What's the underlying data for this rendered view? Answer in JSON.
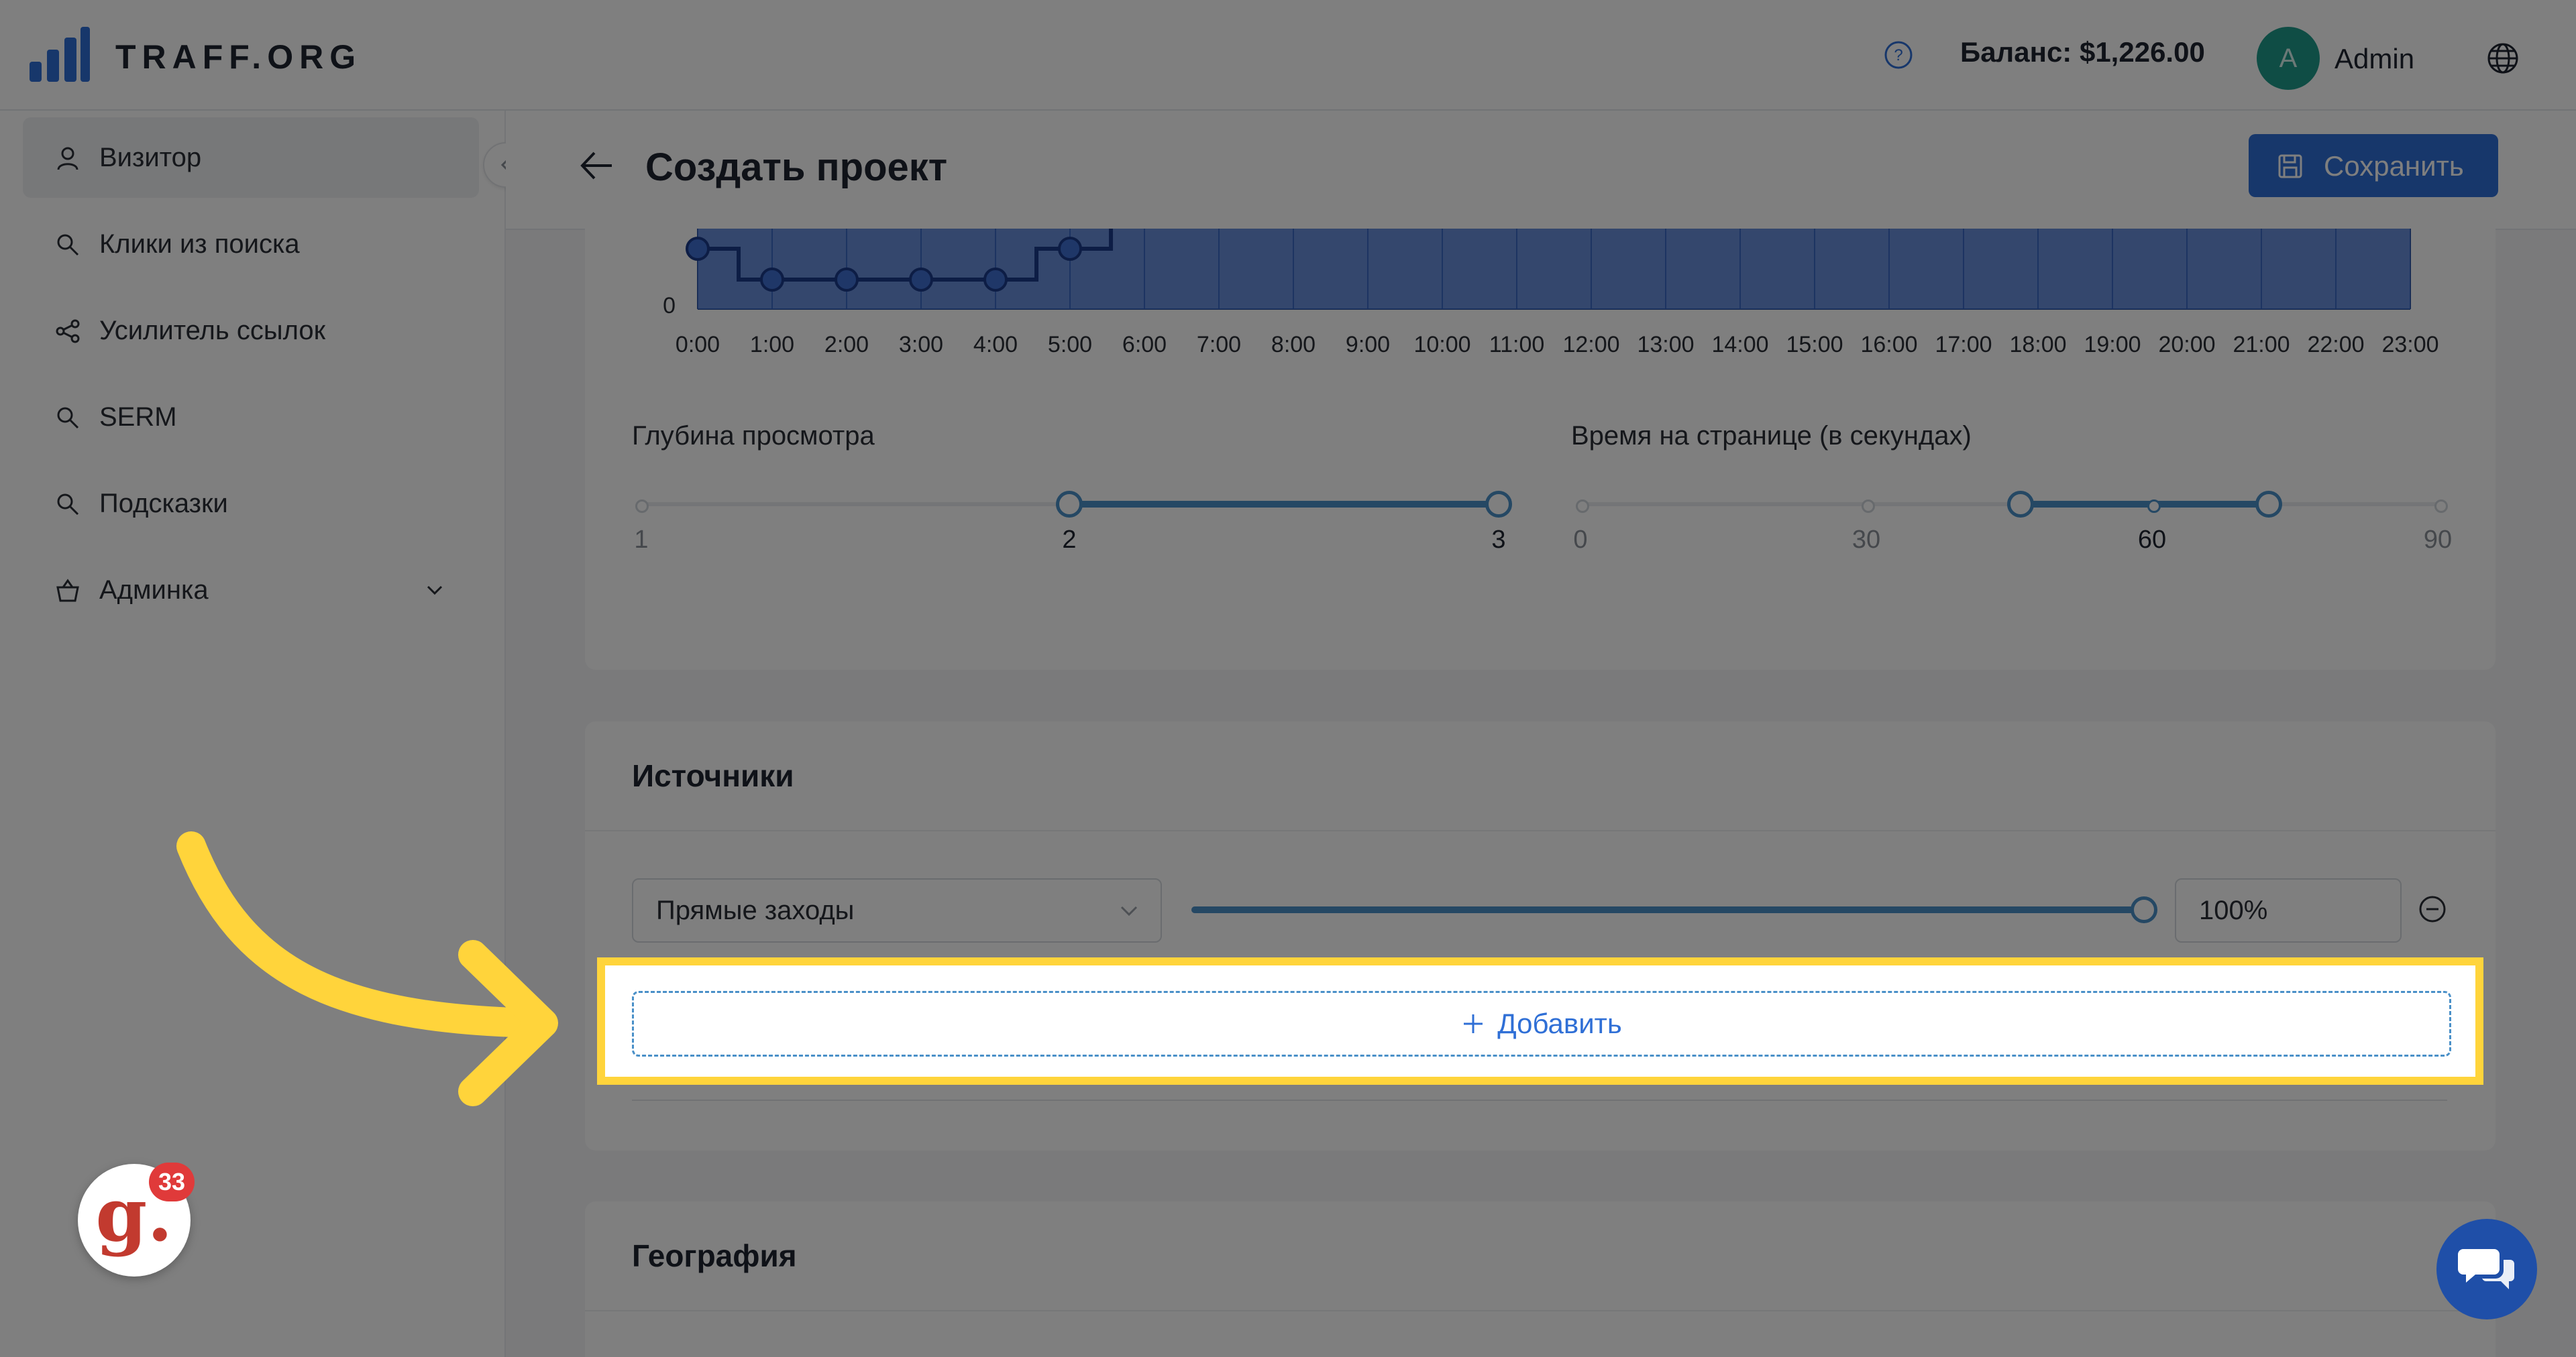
{
  "header": {
    "brand": "TRAFF.ORG",
    "balance": "Баланс: $1,226.00",
    "avatar_letter": "A",
    "user_name": "Admin",
    "help_icon": "question-circle-icon",
    "language_icon": "globe-icon"
  },
  "sidebar": {
    "items": [
      {
        "label": "Визитор",
        "icon": "user-icon",
        "active": true
      },
      {
        "label": "Клики из поиска",
        "icon": "search-icon"
      },
      {
        "label": "Усилитель ссылок",
        "icon": "share-icon"
      },
      {
        "label": "SERM",
        "icon": "search-icon"
      },
      {
        "label": "Подсказки",
        "icon": "search-icon"
      },
      {
        "label": "Админка",
        "icon": "basket-icon",
        "has_submenu": true
      }
    ]
  },
  "page": {
    "title": "Создать проект",
    "save_label": "Сохранить"
  },
  "chart_data": {
    "type": "area",
    "x": [
      "0:00",
      "1:00",
      "2:00",
      "3:00",
      "4:00",
      "5:00",
      "6:00",
      "7:00",
      "8:00",
      "9:00",
      "10:00",
      "11:00",
      "12:00",
      "13:00",
      "14:00",
      "15:00",
      "16:00",
      "17:00",
      "18:00",
      "19:00",
      "20:00",
      "21:00",
      "22:00",
      "23:00"
    ],
    "y_ticks": [
      "0"
    ],
    "accent": "#3f6fd0"
  },
  "depth": {
    "label": "Глубина просмотра",
    "marks": [
      "1",
      "2",
      "3"
    ],
    "selected_range": [
      2,
      3
    ]
  },
  "time_on_page": {
    "label": "Время на странице (в секундах)",
    "marks": [
      "0",
      "30",
      "60",
      "90"
    ],
    "selected_range": [
      45,
      72
    ]
  },
  "sources": {
    "title": "Источники",
    "rows": [
      {
        "source": "Прямые заходы",
        "share": "100%"
      }
    ],
    "add_label": "Добавить"
  },
  "geo": {
    "title": "География"
  },
  "widgets": {
    "g_letter": "g.",
    "g_badge": "33"
  },
  "colors": {
    "primary": "#2f6fd6",
    "slider": "#4a90c8",
    "highlight": "#ffd43b"
  }
}
